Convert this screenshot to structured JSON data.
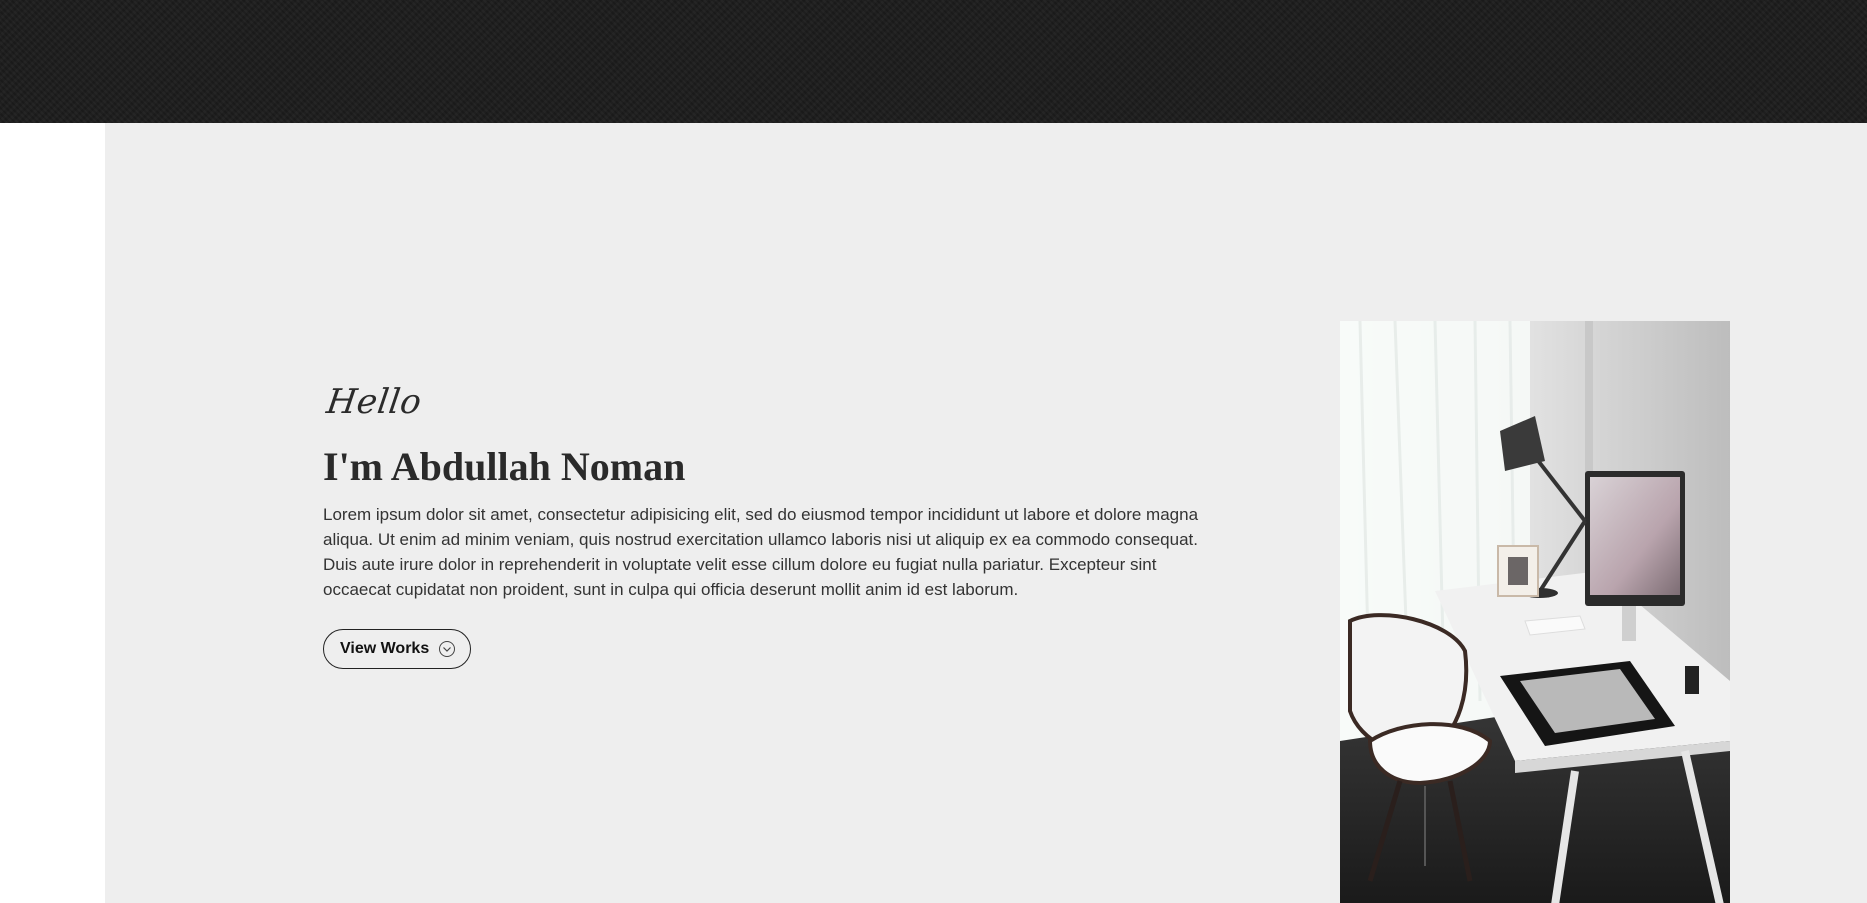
{
  "hero": {
    "greeting": "Hello",
    "name": "I'm Abdullah Noman",
    "bio": "Lorem ipsum dolor sit amet, consectetur adipisicing elit, sed do eiusmod tempor incididunt ut labore et dolore magna aliqua. Ut enim ad minim veniam, quis nostrud exercitation ullamco laboris nisi ut aliquip ex ea commodo consequat. Duis aute irure dolor in reprehenderit in voluptate velit esse cillum dolore eu fugiat nulla pariatur. Excepteur sint occaecat cupidatat non proident, sunt in culpa qui officia deserunt mollit anim id est laborum.",
    "cta_label": "View Works",
    "cta_icon": "chevron-down-circle-icon"
  },
  "colors": {
    "header_bg": "#1c1c1c",
    "hero_bg": "#eeeeee",
    "text": "#2a2a2a"
  }
}
